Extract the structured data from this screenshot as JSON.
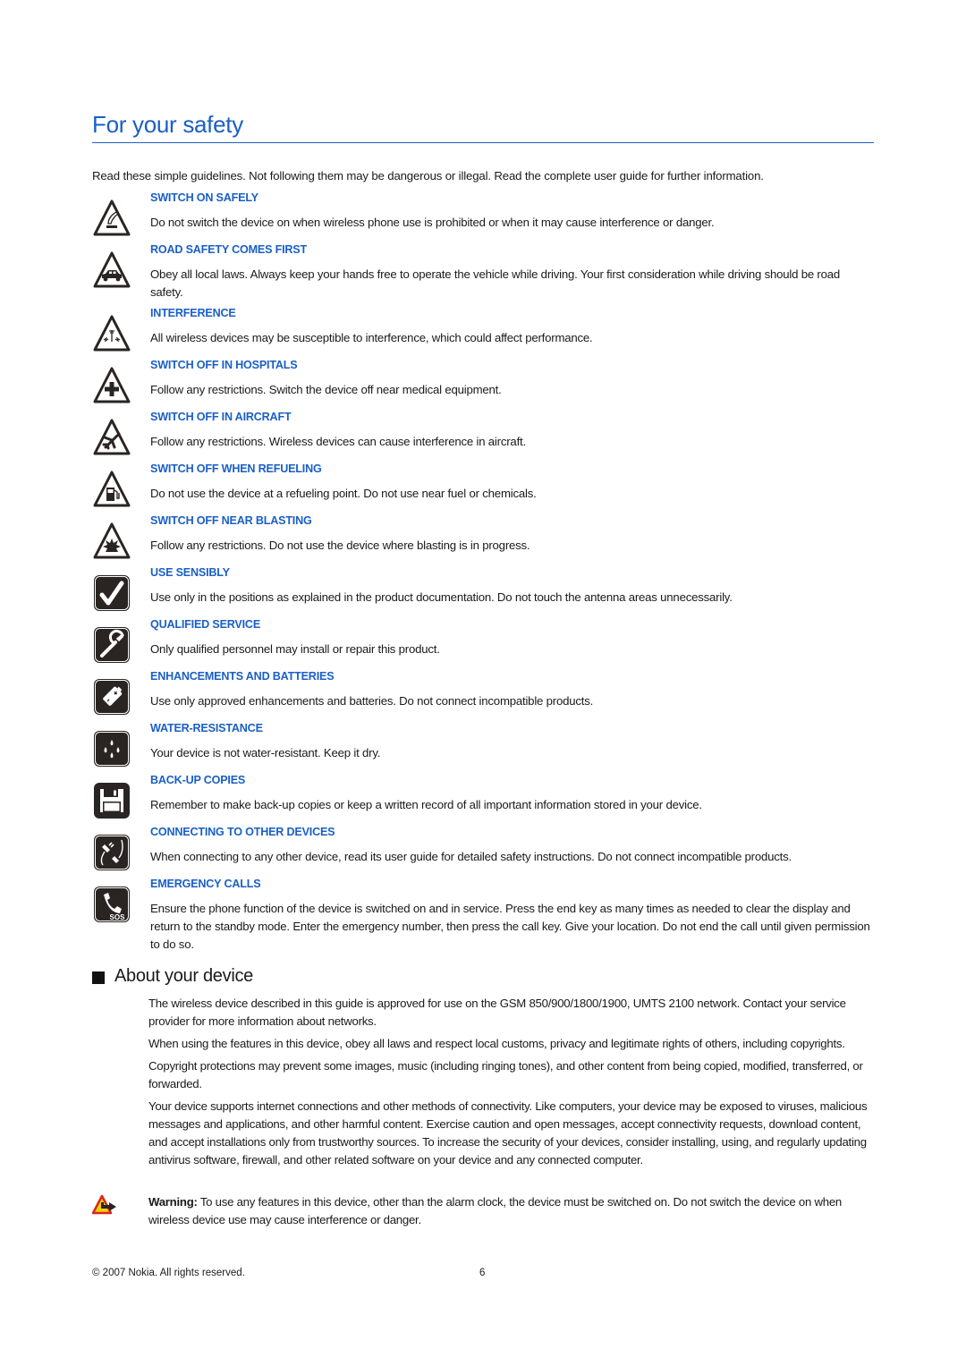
{
  "page": {
    "title": "For your safety",
    "intro": "Read these simple guidelines. Not following them may be dangerous or illegal. Read the complete user guide for further information."
  },
  "safety_items": [
    {
      "icon": "switch-on-hand-icon",
      "heading": "SWITCH ON SAFELY",
      "text": "Do not switch the device on when wireless phone use is prohibited or when it may cause interference or danger."
    },
    {
      "icon": "car-icon",
      "heading": "ROAD SAFETY COMES FIRST",
      "text": "Obey all local laws. Always keep your hands free to operate the vehicle while driving. Your first consideration while driving should be road safety."
    },
    {
      "icon": "antenna-interference-icon",
      "heading": "INTERFERENCE",
      "text": "All wireless devices may be susceptible to interference, which could affect performance."
    },
    {
      "icon": "medical-cross-icon",
      "heading": "SWITCH OFF IN HOSPITALS",
      "text": "Follow any restrictions. Switch the device off near medical equipment."
    },
    {
      "icon": "airplane-icon",
      "heading": "SWITCH OFF IN AIRCRAFT",
      "text": "Follow any restrictions. Wireless devices can cause interference in aircraft."
    },
    {
      "icon": "fuel-pump-icon",
      "heading": "SWITCH OFF WHEN REFUELING",
      "text": "Do not use the device at a refueling point. Do not use near fuel or chemicals."
    },
    {
      "icon": "explosion-icon",
      "heading": "SWITCH OFF NEAR BLASTING",
      "text": "Follow any restrictions. Do not use the device where blasting is in progress."
    },
    {
      "icon": "checkmark-icon",
      "heading": "USE SENSIBLY",
      "text": "Use only in the positions as explained in the product documentation. Do not touch the antenna areas unnecessarily."
    },
    {
      "icon": "wrench-icon",
      "heading": "QUALIFIED SERVICE",
      "text": "Only qualified personnel may install or repair this product."
    },
    {
      "icon": "battery-icon",
      "heading": "ENHANCEMENTS AND BATTERIES",
      "text": "Use only approved enhancements and batteries. Do not connect incompatible products."
    },
    {
      "icon": "water-drops-icon",
      "heading": "WATER-RESISTANCE",
      "text": "Your device is not water-resistant. Keep it dry."
    },
    {
      "icon": "floppy-disk-icon",
      "heading": "BACK-UP COPIES",
      "text": "Remember to make back-up copies or keep a written record of all important information stored in your device."
    },
    {
      "icon": "plug-cable-icon",
      "heading": "CONNECTING TO OTHER DEVICES",
      "text": "When connecting to any other device, read its user guide for detailed safety instructions. Do not connect incompatible products."
    },
    {
      "icon": "phone-sos-icon",
      "heading": "EMERGENCY CALLS",
      "text": "Ensure the phone function of the device is switched on and in service. Press the end key as many times as needed to clear the display and return to the standby mode. Enter the emergency number, then press the call key. Give your location. Do not end the call until given permission to do so."
    }
  ],
  "about": {
    "title": "About your device",
    "paragraphs": [
      "The wireless device described in this guide is approved for use on the GSM 850/900/1800/1900, UMTS 2100 network. Contact your service provider for more information about networks.",
      "When using the features in this device, obey all laws and respect local customs, privacy and legitimate rights of others, including copyrights.",
      "Copyright protections may prevent some images, music (including ringing tones), and other content from being copied, modified, transferred, or forwarded.",
      "Your device supports internet connections and other methods of connectivity. Like computers, your device may be exposed to viruses, malicious messages and applications, and other harmful content. Exercise caution and open messages, accept connectivity requests, download content, and accept installations only from trustworthy sources. To increase the security of your devices, consider installing, using, and regularly updating antivirus software, firewall, and other related software on your device and any connected computer."
    ],
    "warning_label": "Warning:",
    "warning_text": " To use any features in this device, other than the alarm clock, the device must be switched on. Do not switch the device on when wireless device use may cause interference or danger."
  },
  "footer": {
    "copyright": "© 2007 Nokia. All rights reserved.",
    "page_number": "6"
  },
  "colors": {
    "accent": "#1a5fc7",
    "text": "#1a1a1a",
    "icon": "#2a2522"
  }
}
